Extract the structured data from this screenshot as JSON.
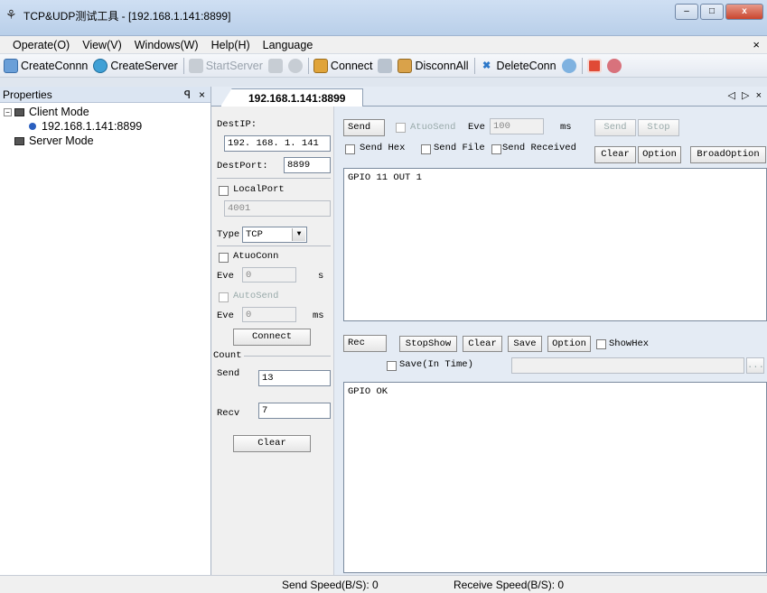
{
  "window": {
    "title": "TCP&UDP测试工具 - [192.168.1.141:8899]",
    "controls": [
      "–",
      "□",
      "x"
    ]
  },
  "menu": {
    "items": [
      "Operate(O)",
      "View(V)",
      "Windows(W)",
      "Help(H)",
      "Language"
    ],
    "close": "×"
  },
  "toolbar": {
    "create_conn": "CreateConnn",
    "create_server": "CreateServer",
    "start_server": "StartServer",
    "connect": "Connect",
    "disconn_all": "DisconnAll",
    "delete_conn": "DeleteConn"
  },
  "properties": {
    "title": "Properties",
    "pin": "ꟼ",
    "close": "×",
    "tree": {
      "client_mode": "Client Mode",
      "connection": "192.168.1.141:8899",
      "server_mode": "Server Mode"
    }
  },
  "tab": {
    "label": "192.168.1.141:8899",
    "nav": "◁ ▷ ×"
  },
  "settings": {
    "dest_ip_label": "DestIP:",
    "dest_ip": "192. 168. 1. 141",
    "dest_port_label": "DestPort:",
    "dest_port": "8899",
    "local_port_label": "LocalPort",
    "local_port": "4001",
    "type_label": "Type",
    "type_value": "TCP",
    "auto_conn_label": "AtuoConn",
    "auto_conn_eve_label": "Eve",
    "auto_conn_eve": "0",
    "auto_conn_unit": "s",
    "auto_send_label": "AutoSend",
    "auto_send_eve_label": "Eve",
    "auto_send_eve": "0",
    "auto_send_unit": "ms",
    "connect_button": "Connect",
    "count_label": "Count",
    "send_label": "Send",
    "send_count": "13",
    "recv_label": "Recv",
    "recv_count": "7",
    "clear_button": "Clear"
  },
  "send_panel": {
    "send_label": "Send",
    "auto_send_label": "AtuoSend",
    "eve_label": "Eve",
    "eve_value": "100",
    "ms_label": "ms",
    "send_button": "Send",
    "stop_button": "Stop",
    "send_hex_label": "Send Hex",
    "send_file_label": "Send File",
    "send_received_label": "Send Received",
    "clear_button": "Clear",
    "option_button": "Option",
    "broad_option_button": "BroadOption",
    "content": "GPIO 11 OUT 1"
  },
  "rec_panel": {
    "rec_label": "Rec",
    "stop_show_button": "StopShow",
    "clear_button": "Clear",
    "save_button": "Save",
    "option_button": "Option",
    "show_hex_label": "ShowHex",
    "save_in_time_label": "Save(In Time)",
    "browse_button": "...",
    "content": "GPIO OK"
  },
  "status": {
    "send_speed": "Send Speed(B/S): 0",
    "receive_speed": "Receive Speed(B/S): 0"
  },
  "colors": {
    "title_bar": "#c4d7ee",
    "close_button": "#c9452e",
    "panel_bg": "#f0f0f0",
    "accent_blue": "#2b5fbf"
  }
}
